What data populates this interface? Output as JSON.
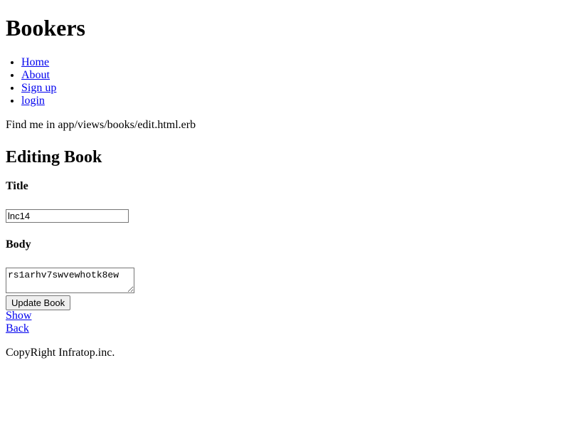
{
  "header": {
    "site_title": "Bookers"
  },
  "nav": {
    "items": [
      {
        "label": "Home"
      },
      {
        "label": "About"
      },
      {
        "label": "Sign up"
      },
      {
        "label": "login"
      }
    ]
  },
  "find_me_text": "Find me in app/views/books/edit.html.erb",
  "page": {
    "heading": "Editing Book"
  },
  "form": {
    "title_label": "Title",
    "title_value": "lnc14",
    "body_label": "Body",
    "body_value": "rs1arhv7swvewhotk8ew",
    "submit_label": "Update Book"
  },
  "links": {
    "show": "Show",
    "back": "Back"
  },
  "footer": {
    "copyright": "CopyRight Infratop.inc."
  }
}
